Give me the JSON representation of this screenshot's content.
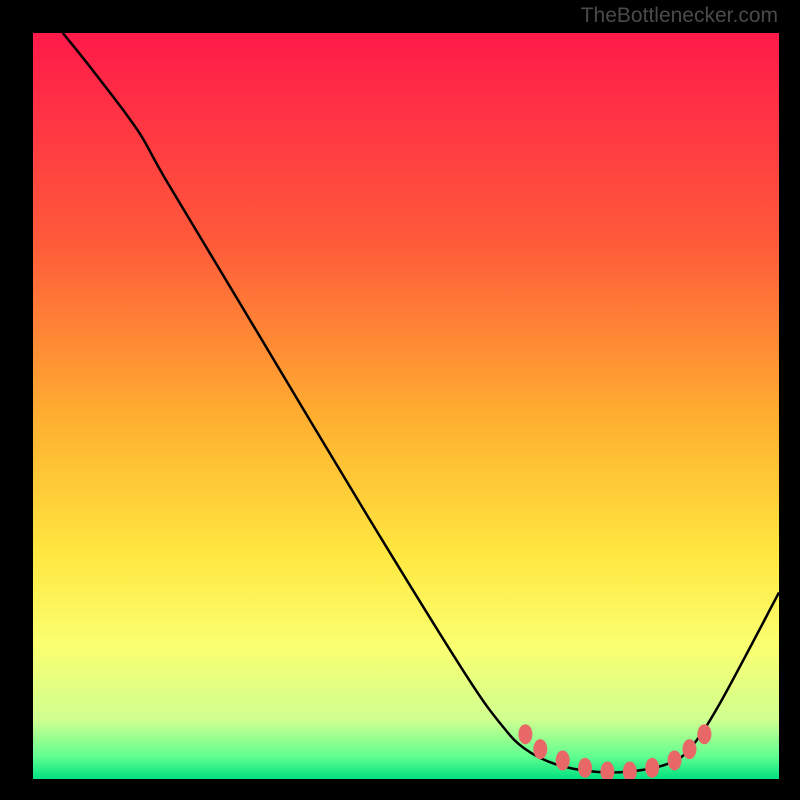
{
  "watermark": "TheBottlenecker.com",
  "chart_data": {
    "type": "line",
    "title": "",
    "xlabel": "",
    "ylabel": "",
    "xlim": [
      0,
      100
    ],
    "ylim": [
      0,
      100
    ],
    "gradient_stops": [
      {
        "offset": 0,
        "color": "#ff1a4a"
      },
      {
        "offset": 0.28,
        "color": "#ff5a3a"
      },
      {
        "offset": 0.52,
        "color": "#ffb030"
      },
      {
        "offset": 0.7,
        "color": "#ffe840"
      },
      {
        "offset": 0.82,
        "color": "#fbff70"
      },
      {
        "offset": 0.92,
        "color": "#d0ff90"
      },
      {
        "offset": 0.97,
        "color": "#60ff90"
      },
      {
        "offset": 1.0,
        "color": "#00e080"
      }
    ],
    "curve_points": [
      {
        "x": 4,
        "y": 100
      },
      {
        "x": 8,
        "y": 95
      },
      {
        "x": 14,
        "y": 87
      },
      {
        "x": 18,
        "y": 80
      },
      {
        "x": 30,
        "y": 60
      },
      {
        "x": 45,
        "y": 35
      },
      {
        "x": 58,
        "y": 14
      },
      {
        "x": 63,
        "y": 7
      },
      {
        "x": 66,
        "y": 4
      },
      {
        "x": 70,
        "y": 2
      },
      {
        "x": 75,
        "y": 1
      },
      {
        "x": 80,
        "y": 1
      },
      {
        "x": 85,
        "y": 2
      },
      {
        "x": 88,
        "y": 4
      },
      {
        "x": 92,
        "y": 10
      },
      {
        "x": 100,
        "y": 25
      }
    ],
    "marker_points": [
      {
        "x": 66,
        "y": 6
      },
      {
        "x": 68,
        "y": 4
      },
      {
        "x": 71,
        "y": 2.5
      },
      {
        "x": 74,
        "y": 1.5
      },
      {
        "x": 77,
        "y": 1
      },
      {
        "x": 80,
        "y": 1
      },
      {
        "x": 83,
        "y": 1.5
      },
      {
        "x": 86,
        "y": 2.5
      },
      {
        "x": 88,
        "y": 4
      },
      {
        "x": 90,
        "y": 6
      }
    ],
    "marker_color": "#e86868",
    "line_color": "#000000"
  }
}
